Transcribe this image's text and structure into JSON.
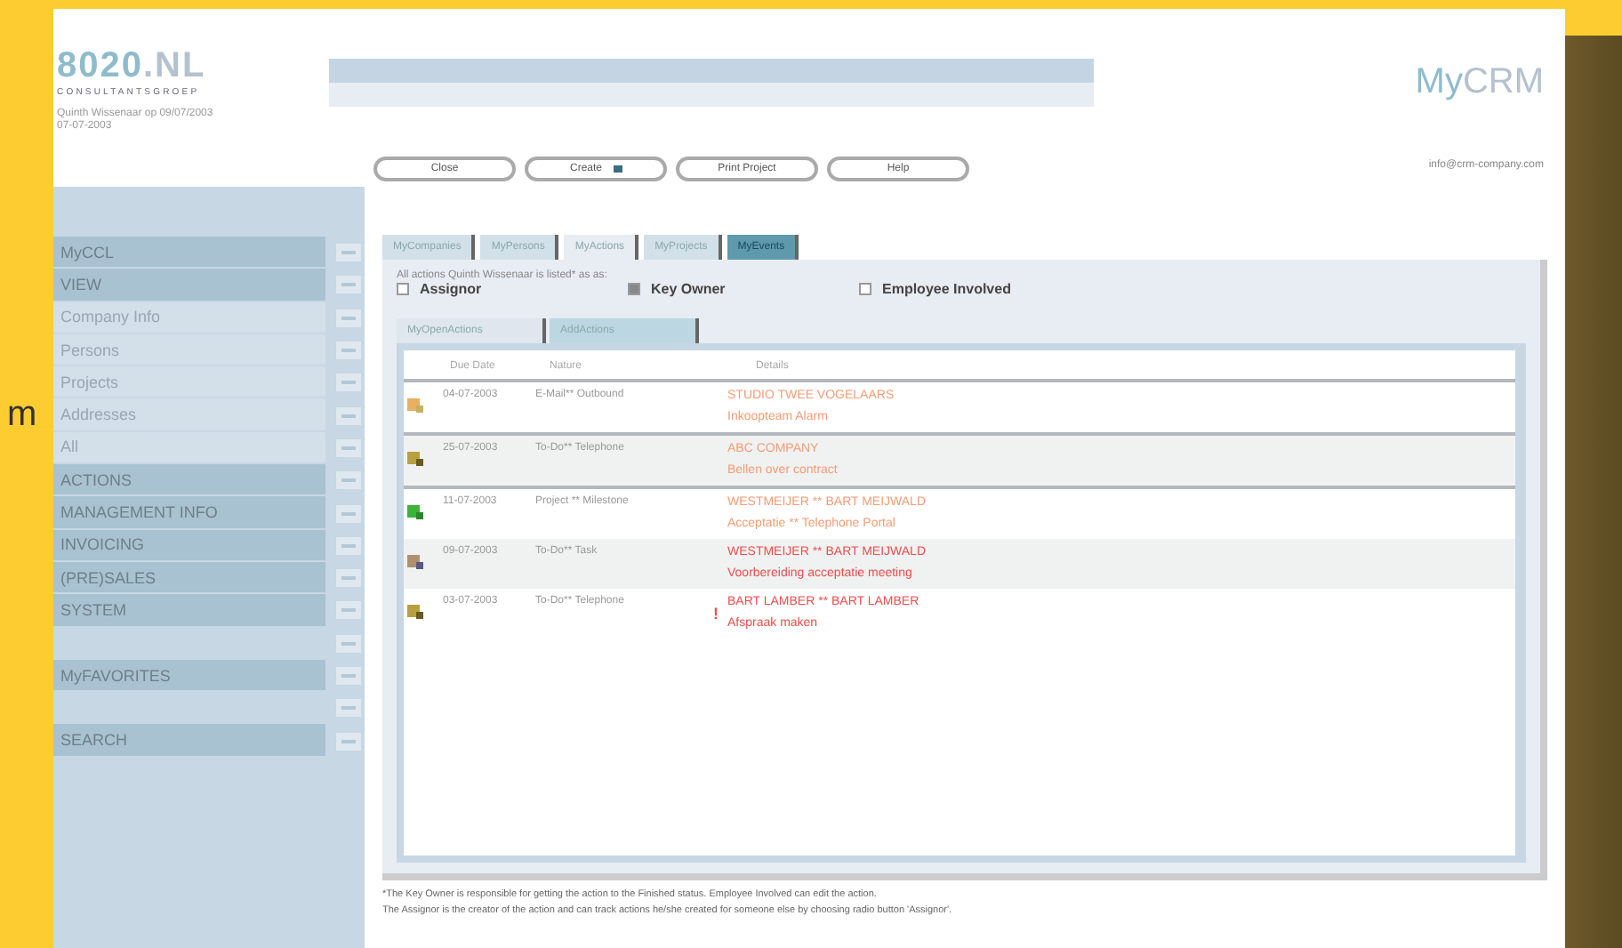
{
  "side_fragment": "m",
  "header": {
    "logo_main": "8020",
    "logo_suffix": ".NL",
    "logo_sub": "CONSULTANTSGROEP",
    "user_line": "Quinth Wissenaar op 09/07/2003",
    "date": "07-07-2003",
    "brand_my": "My",
    "brand_crm": "CRM",
    "email": "info@crm-company.com"
  },
  "toolbar": [
    {
      "label": "Close",
      "dropdown": false
    },
    {
      "label": "Create",
      "dropdown": true
    },
    {
      "label": "Print Project",
      "dropdown": false
    },
    {
      "label": "Help",
      "dropdown": false
    }
  ],
  "sidebar": {
    "items": [
      {
        "label": "MyCCL",
        "kind": "section"
      },
      {
        "label": "VIEW",
        "kind": "section"
      },
      {
        "label": "Company Info",
        "kind": "link"
      },
      {
        "label": "Persons",
        "kind": "link"
      },
      {
        "label": "Projects",
        "kind": "link"
      },
      {
        "label": "Addresses",
        "kind": "link"
      },
      {
        "label": "All",
        "kind": "link"
      },
      {
        "label": "ACTIONS",
        "kind": "section"
      },
      {
        "label": "MANAGEMENT INFO",
        "kind": "section"
      },
      {
        "label": "INVOICING",
        "kind": "section"
      },
      {
        "label": "(PRE)SALES",
        "kind": "section"
      },
      {
        "label": "SYSTEM",
        "kind": "section"
      },
      {
        "kind": "spacer"
      },
      {
        "label": "MyFAVORITES",
        "kind": "section"
      },
      {
        "kind": "spacer"
      },
      {
        "label": "SEARCH",
        "kind": "section"
      }
    ]
  },
  "tabs": [
    {
      "label": "MyCompanies",
      "selected": false,
      "highlight": false
    },
    {
      "label": "MyPersons",
      "selected": false,
      "highlight": false
    },
    {
      "label": "MyActions",
      "selected": true,
      "highlight": false
    },
    {
      "label": "MyProjects",
      "selected": false,
      "highlight": false
    },
    {
      "label": "MyEvents",
      "selected": false,
      "highlight": true
    }
  ],
  "filter": {
    "caption": "All actions Quinth Wissenaar is listed* as as:",
    "options": [
      {
        "label": "Assignor",
        "selected": false
      },
      {
        "label": "Key Owner",
        "selected": true
      },
      {
        "label": "Employee Involved",
        "selected": false
      }
    ]
  },
  "subtabs": [
    {
      "label": "MyOpenActions",
      "selected": true
    },
    {
      "label": "AddActions",
      "selected": false
    }
  ],
  "table": {
    "columns": [
      "Due Date",
      "Nature",
      "Details"
    ],
    "rows": [
      {
        "kind": "mail",
        "due": "04-07-2003",
        "nature": "E-Mail** Outbound",
        "priority": "",
        "details": [
          "STUDIO TWEE VOGELAARS",
          "Inkoopteam Alarm"
        ],
        "urgent": false
      },
      {
        "kind": "todo",
        "due": "25-07-2003",
        "nature": "To-Do** Telephone",
        "priority": "",
        "details": [
          "ABC COMPANY",
          "Bellen over contract"
        ],
        "urgent": false
      },
      {
        "kind": "milestone",
        "due": "11-07-2003",
        "nature": "Project ** Milestone",
        "priority": "",
        "details": [
          "WESTMEIJER ** BART MEIJWALD",
          "Acceptatie ** Telephone Portal"
        ],
        "urgent": false
      },
      {
        "kind": "task",
        "due": "09-07-2003",
        "nature": "To-Do** Task",
        "priority": "",
        "details": [
          "WESTMEIJER ** BART MEIJWALD",
          "Voorbereiding acceptatie meeting"
        ],
        "urgent": true
      },
      {
        "kind": "todo",
        "due": "03-07-2003",
        "nature": "To-Do** Telephone",
        "priority": "!",
        "details": [
          "BART LAMBER ** BART LAMBER",
          "Afspraak maken"
        ],
        "urgent": true
      }
    ]
  },
  "footnotes": [
    "*The Key Owner is responsible for getting the action to the Finished status. Employee Involved can edit the action.",
    "The Assignor is the creator of the action and can track actions he/she created for someone else by choosing radio button 'Assignor'."
  ]
}
